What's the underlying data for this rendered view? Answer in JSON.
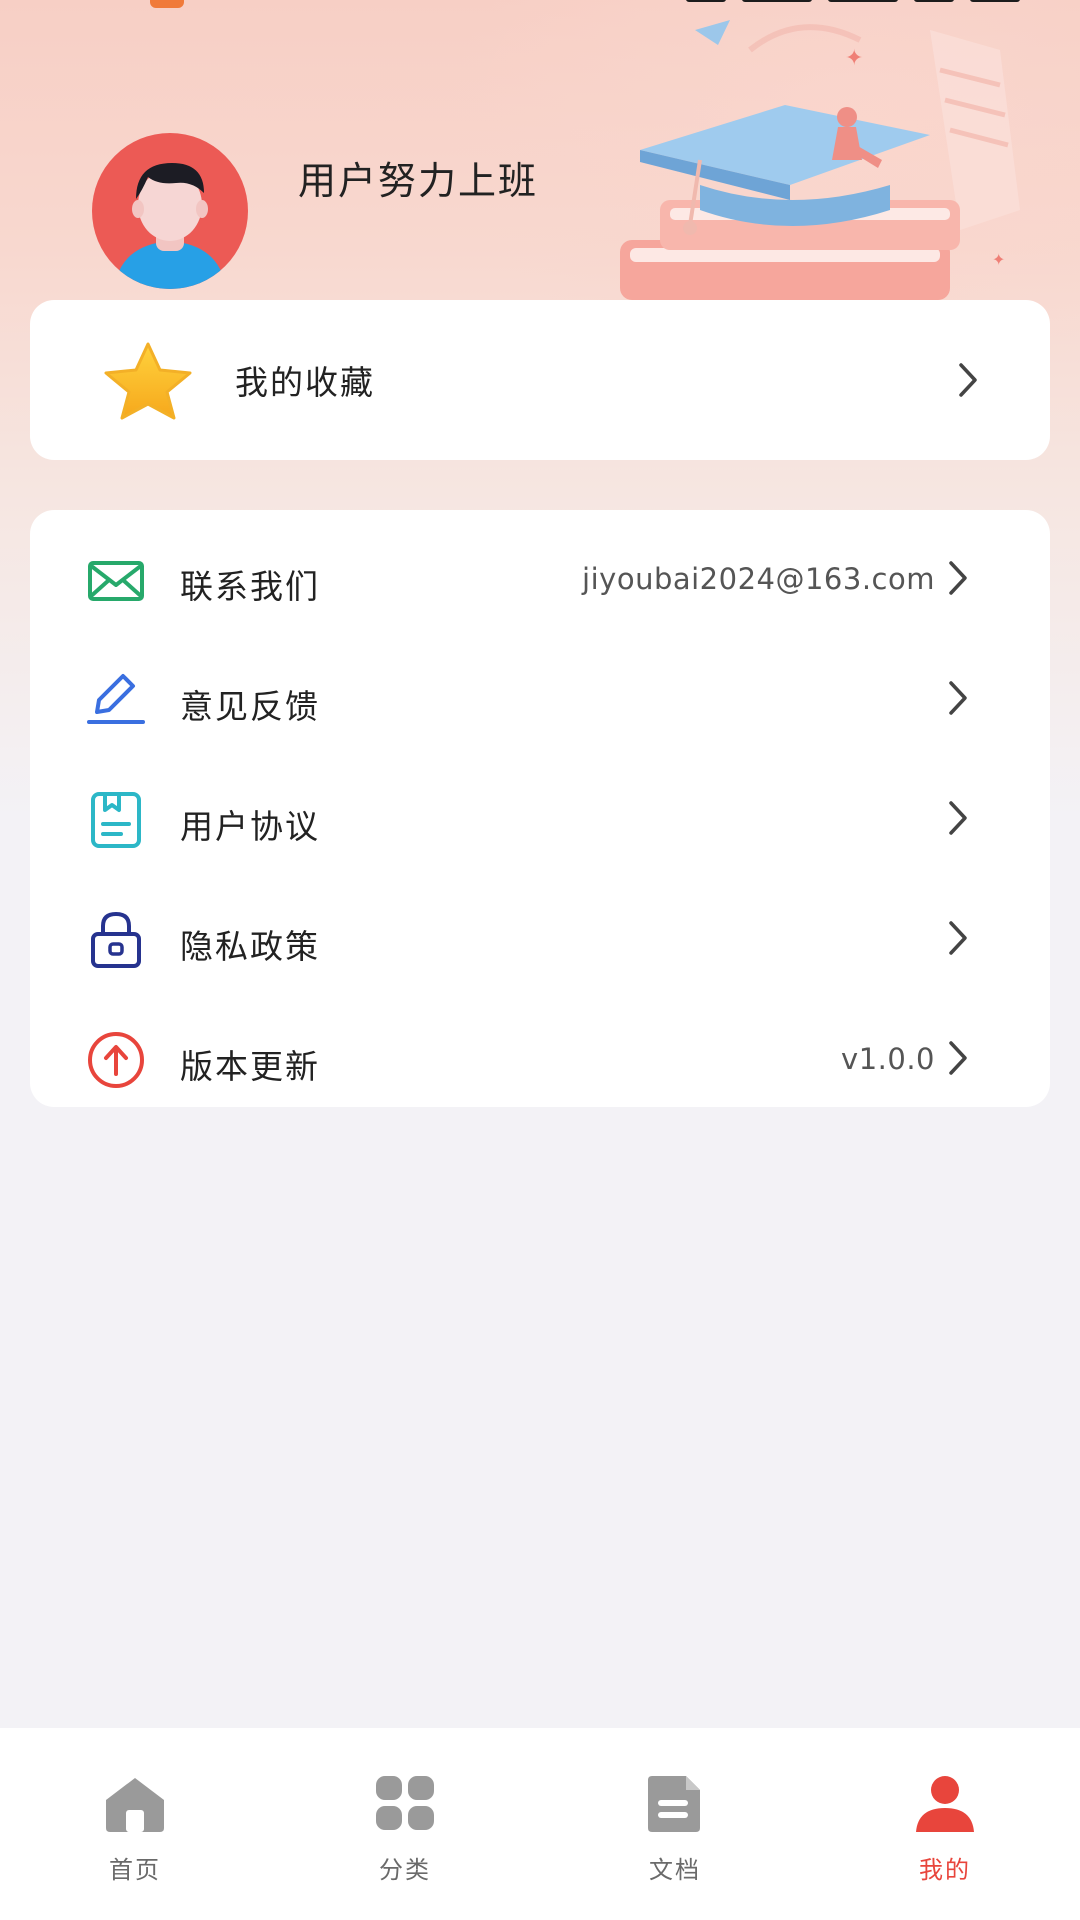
{
  "profile": {
    "username": "用户努力上班"
  },
  "favorites": {
    "label": "我的收藏"
  },
  "menu": {
    "items": [
      {
        "label": "联系我们",
        "value": "jiyoubai2024@163.com",
        "icon": "mail-icon",
        "color": "#27a96b"
      },
      {
        "label": "意见反馈",
        "value": "",
        "icon": "edit-icon",
        "color": "#3a6fe0"
      },
      {
        "label": "用户协议",
        "value": "",
        "icon": "document-icon",
        "color": "#2cb7c7"
      },
      {
        "label": "隐私政策",
        "value": "",
        "icon": "lock-icon",
        "color": "#26338f"
      },
      {
        "label": "版本更新",
        "value": "v1.0.0",
        "icon": "upgrade-icon",
        "color": "#e8453c"
      }
    ]
  },
  "tabbar": {
    "tabs": [
      {
        "label": "首页",
        "icon": "home-icon",
        "active": false
      },
      {
        "label": "分类",
        "icon": "grid-icon",
        "active": false
      },
      {
        "label": "文档",
        "icon": "file-icon",
        "active": false
      },
      {
        "label": "我的",
        "icon": "user-icon",
        "active": true
      }
    ],
    "active_color": "#e8453c",
    "inactive_color": "#9a9a9a"
  }
}
